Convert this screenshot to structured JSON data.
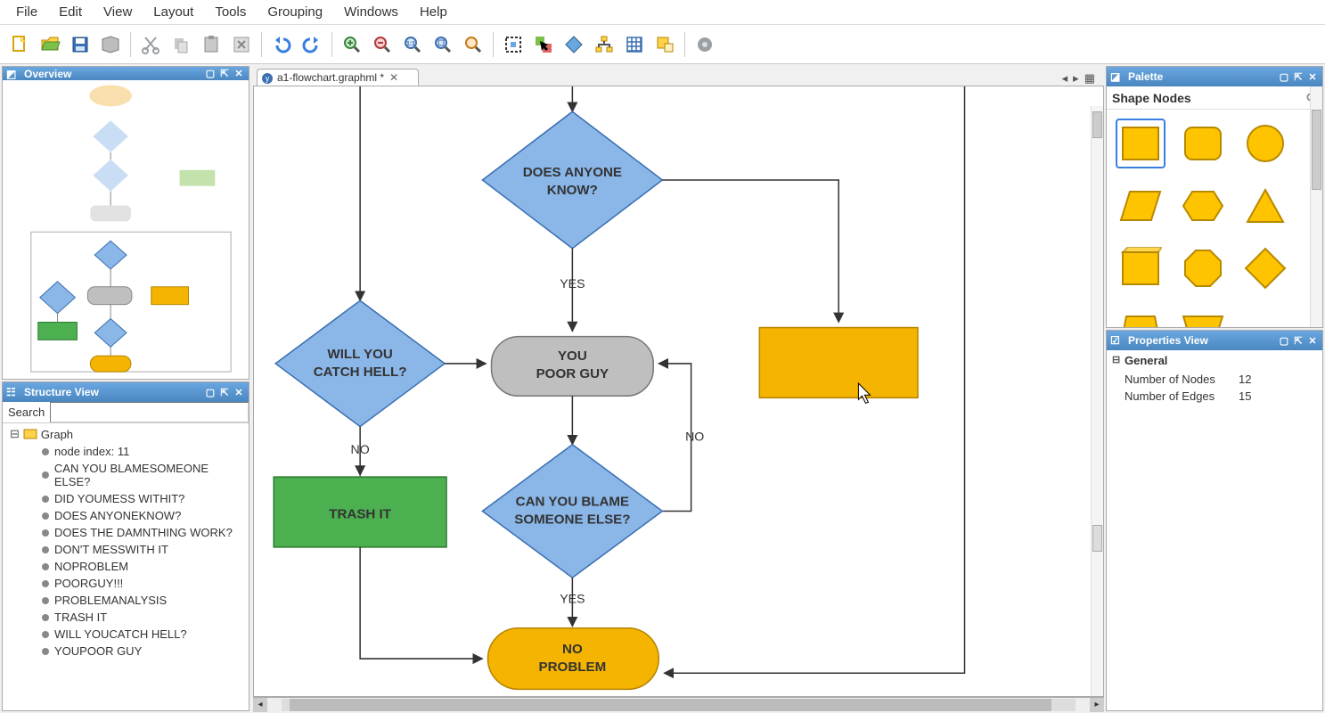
{
  "menu": {
    "items": [
      "File",
      "Edit",
      "View",
      "Layout",
      "Tools",
      "Grouping",
      "Windows",
      "Help"
    ]
  },
  "toolbar_icons": [
    "new-icon",
    "open-icon",
    "save-icon",
    "print-icon",
    "cut-icon",
    "copy-icon",
    "paste-icon",
    "delete-icon",
    "undo-icon",
    "redo-icon",
    "zoom-in-icon",
    "zoom-out-icon",
    "zoom-actual-icon",
    "zoom-fit-icon",
    "zoom-region-icon",
    "fit-content-icon",
    "selection-mode-icon",
    "marquee-icon",
    "hierarchy-icon",
    "grid-icon",
    "snap-icon",
    "settings-icon"
  ],
  "panels": {
    "overview": {
      "title": "Overview"
    },
    "structure": {
      "title": "Structure View",
      "search_label": "Search",
      "search_value": "",
      "root": "Graph",
      "children": [
        "node index: 11",
        "CAN YOU BLAMESOMEONE ELSE?",
        "DID YOUMESS WITHIT?",
        "DOES ANYONEKNOW?",
        "DOES THE DAMNTHING WORK?",
        "DON'T MESSWITH IT",
        "NOPROBLEM",
        "POORGUY!!!",
        "PROBLEMANALYSIS",
        "TRASH IT",
        "WILL YOUCATCH HELL?",
        "YOUPOOR GUY"
      ]
    },
    "palette": {
      "title": "Palette",
      "section": "Shape Nodes"
    },
    "properties": {
      "title": "Properties View",
      "section": "General",
      "rows": [
        {
          "k": "Number of Nodes",
          "v": "12"
        },
        {
          "k": "Number of Edges",
          "v": "15"
        }
      ]
    }
  },
  "tab": {
    "label": "a1-flowchart.graphml *"
  },
  "flowchart": {
    "does_anyone_know": "DOES ANYONE\nKNOW?",
    "will_you_catch_hell": "WILL YOU\nCATCH HELL?",
    "you_poor_guy": "YOU\nPOOR GUY",
    "can_you_blame": "CAN YOU BLAME\nSOMEONE ELSE?",
    "trash_it": "TRASH IT",
    "no_problem": "NO\nPROBLEM",
    "yes1": "YES",
    "yes2": "YES",
    "no1": "NO",
    "no2": "NO"
  }
}
